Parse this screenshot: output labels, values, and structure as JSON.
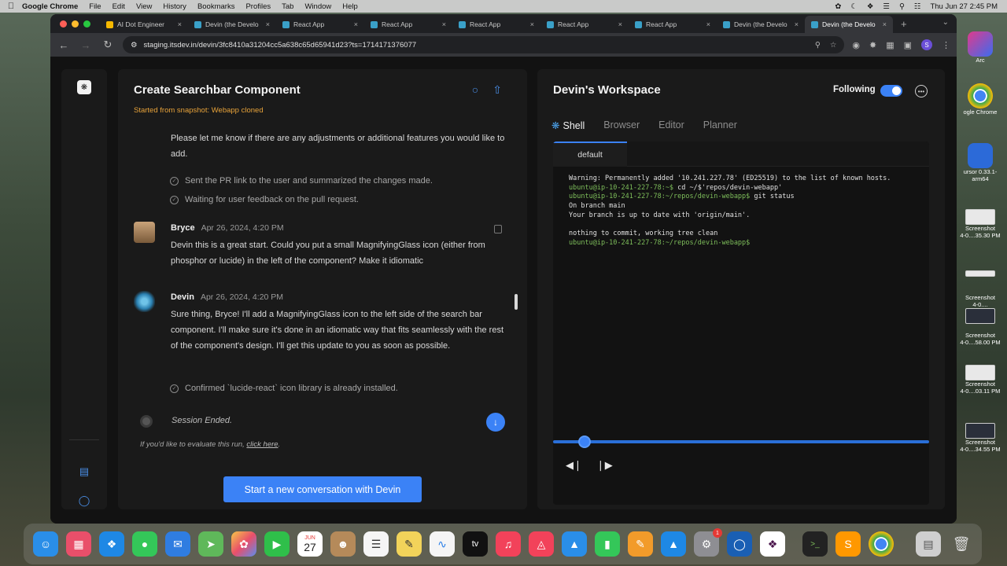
{
  "menubar": {
    "app_name": "Google Chrome",
    "items": [
      "File",
      "Edit",
      "View",
      "History",
      "Bookmarks",
      "Profiles",
      "Tab",
      "Window",
      "Help"
    ],
    "clock": "Thu Jun 27  2:45 PM"
  },
  "browser": {
    "tabs": [
      {
        "title": "AI Dot Engineer",
        "fav_color": "#f5b800"
      },
      {
        "title": "Devin (the Develo",
        "fav_color": "#3aa0c8"
      },
      {
        "title": "React App",
        "fav_color": "#3aa0c8"
      },
      {
        "title": "React App",
        "fav_color": "#3aa0c8"
      },
      {
        "title": "React App",
        "fav_color": "#3aa0c8"
      },
      {
        "title": "React App",
        "fav_color": "#3aa0c8"
      },
      {
        "title": "React App",
        "fav_color": "#3aa0c8"
      },
      {
        "title": "Devin (the Develo",
        "fav_color": "#3aa0c8"
      },
      {
        "title": "Devin (the Develo",
        "fav_color": "#3aa0c8"
      }
    ],
    "url": "staging.itsdev.in/devin/3fc8410a31204cc5a638c65d65941d23?ts=1714171376077",
    "profile_initial": "S"
  },
  "chat": {
    "title": "Create Searchbar Component",
    "snapshot_label": "Started from snapshot:",
    "snapshot_value": "Webapp cloned",
    "intro_text": "Please let me know if there are any adjustments or additional features you would like to add.",
    "checks_top": [
      "Sent the PR link to the user and summarized the changes made.",
      "Waiting for user feedback on the pull request."
    ],
    "msg1": {
      "author": "Bryce",
      "time": "Apr 26, 2024, 4:20 PM",
      "text": "Devin this is a great start. Could you put a small MagnifyingGlass icon (either from phosphor or lucide) in the left of the component? Make it idiomatic"
    },
    "msg2": {
      "author": "Devin",
      "time": "Apr 26, 2024, 4:20 PM",
      "text": "Sure thing, Bryce! I'll add a MagnifyingGlass icon to the left side of the search bar component. I'll make sure it's done in an idiomatic way that fits seamlessly with the rest of the component's design. I'll get this update to you as soon as possible."
    },
    "check_bottom": "Confirmed `lucide-react` icon library is already installed.",
    "session_ended": "Session Ended.",
    "eval_prefix": "If you'd like to evaluate this run,",
    "eval_link": "click here",
    "new_convo_button": "Start a new conversation with Devin"
  },
  "workspace": {
    "title": "Devin's Workspace",
    "following_label": "Following",
    "following_on": true,
    "tabs": [
      "Shell",
      "Browser",
      "Editor",
      "Planner"
    ],
    "active_tab": "Shell",
    "terminal_tab": "default",
    "terminal_lines": [
      {
        "kind": "out",
        "text": "Warning: Permanently added '10.241.227.78' (ED25519) to the list of known hosts."
      },
      {
        "kind": "prompt",
        "prompt": "ubuntu@ip-10-241-227-78:~$",
        "cmd": " cd ~/$'repos/devin-webapp'"
      },
      {
        "kind": "prompt",
        "prompt": "ubuntu@ip-10-241-227-78:~/repos/devin-webapp$",
        "cmd": " git status"
      },
      {
        "kind": "out",
        "text": "On branch main"
      },
      {
        "kind": "out",
        "text": "Your branch is up to date with 'origin/main'."
      },
      {
        "kind": "out",
        "text": ""
      },
      {
        "kind": "out",
        "text": "nothing to commit, working tree clean"
      },
      {
        "kind": "prompt",
        "prompt": "ubuntu@ip-10-241-227-78:~/repos/devin-webapp$",
        "cmd": ""
      }
    ],
    "playback_progress": 0.08
  },
  "desktop": {
    "labels": [
      "Arc",
      "ogle Chrome",
      "ursor 0.33.1-\narm64",
      "Screenshot\n4-0....35.30 PM",
      "Screenshot\n4-0....",
      "Screenshot\n4-0....58.00 PM",
      "Screenshot\n4-0....03.11 PM",
      "Screenshot\n4-0....34.55 PM"
    ]
  },
  "dock": {
    "calendar_month": "JUN",
    "calendar_day": "27",
    "apple_tv": "tv",
    "settings_badge": "1"
  }
}
